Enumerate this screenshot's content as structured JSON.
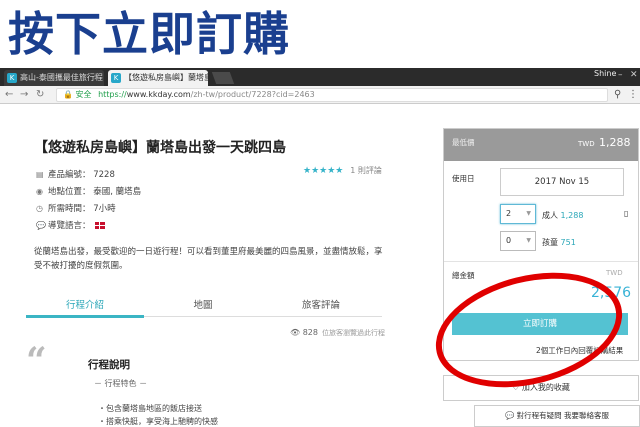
{
  "annotation": {
    "title": "按下立即訂購"
  },
  "browser": {
    "tabs": [
      {
        "label": "高山-泰國攜最佳旅行程"
      },
      {
        "label": "【悠遊私房島嶼】蘭塔島"
      }
    ],
    "user": "Shine",
    "security_label": "安全",
    "url_proto": "https://",
    "url_host": "www.kkday.com",
    "url_path": "/zh-tw/product/7228?cid=2463"
  },
  "product": {
    "title": "【悠遊私房島嶼】蘭塔島出發一天跳四島",
    "code_label": "產品編號：",
    "code": "7228",
    "location_label": "地點位置：",
    "location": "泰國, 蘭塔島",
    "duration_label": "所需時間：",
    "duration": "7小時",
    "language_label": "導覽語言：",
    "rating_stars": "★★★★★",
    "rating_count": "1",
    "rating_label": "則評論",
    "description": "從蘭塔島出發，最受歡迎的一日遊行程！可以看到董里府最美麗的四島風景，並盡情放鬆，享受不被打擾的度假氛圍。"
  },
  "page_tabs": [
    {
      "label": "行程介紹"
    },
    {
      "label": "地圖"
    },
    {
      "label": "旅客評論"
    }
  ],
  "views": {
    "count": "828",
    "label": "位旅客瀏覽過此行程"
  },
  "itinerary": {
    "quote": "“",
    "title": "行程說明",
    "subtitle": "－ 行程特色 －",
    "bullets": [
      "・包含蘭塔島地區的飯店接送",
      "・搭乘快艇，享受海上馳騁的快感"
    ]
  },
  "booking": {
    "min_price_label": "最低價",
    "currency": "TWD",
    "min_price": "1,288",
    "date_label": "使用日",
    "date": "2017 Nov 15",
    "adult_qty": "2",
    "adult_label": "成人",
    "adult_price": "1,288",
    "child_qty": "0",
    "child_label": "孩童",
    "child_price": "751",
    "total_label": "總金額",
    "total_currency": "TWD",
    "total": "2,576",
    "book_label": "立即訂購",
    "confirm_note": "2個工作日內回覆訂購結果",
    "favorite_label": "加入我的收藏",
    "ask_label": "對行程有疑問 我要聯絡客服"
  },
  "colors": {
    "accent": "#54c2d2",
    "annotation_ring": "#e00000",
    "heading": "#1a3f8f"
  }
}
